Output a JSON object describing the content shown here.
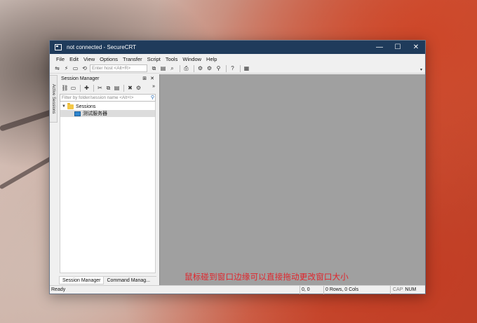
{
  "window": {
    "title": "not connected - SecureCRT",
    "minimize_glyph": "—",
    "maximize_glyph": "☐",
    "close_glyph": "✕"
  },
  "menubar": {
    "items": [
      "File",
      "Edit",
      "View",
      "Options",
      "Transfer",
      "Script",
      "Tools",
      "Window",
      "Help"
    ]
  },
  "toolbar": {
    "host_placeholder": "Enter host <Alt+R>"
  },
  "sidebar_tab": {
    "label": "Active Sessions"
  },
  "session_manager": {
    "title": "Session Manager",
    "pin_glyph": "⊞",
    "close_glyph": "✕",
    "filter_placeholder": "Filter by folder/session name <Alt+I>",
    "more_glyph": "»",
    "tree": {
      "root_label": "Sessions",
      "children": [
        "测试服务器"
      ]
    },
    "tabs": [
      "Session Manager",
      "Command Manag..."
    ]
  },
  "overlay_note": "鼠标碰到窗口边缘可以直接拖动更改窗口大小",
  "statusbar": {
    "ready": "Ready",
    "position": "0, 0",
    "rows_cols": "0 Rows, 0 Cols",
    "cap": "CAP",
    "num": "NUM"
  },
  "colors": {
    "titlebar": "#1f3b5b",
    "main_area": "#a0a0a0",
    "note_text": "#e0242b"
  }
}
